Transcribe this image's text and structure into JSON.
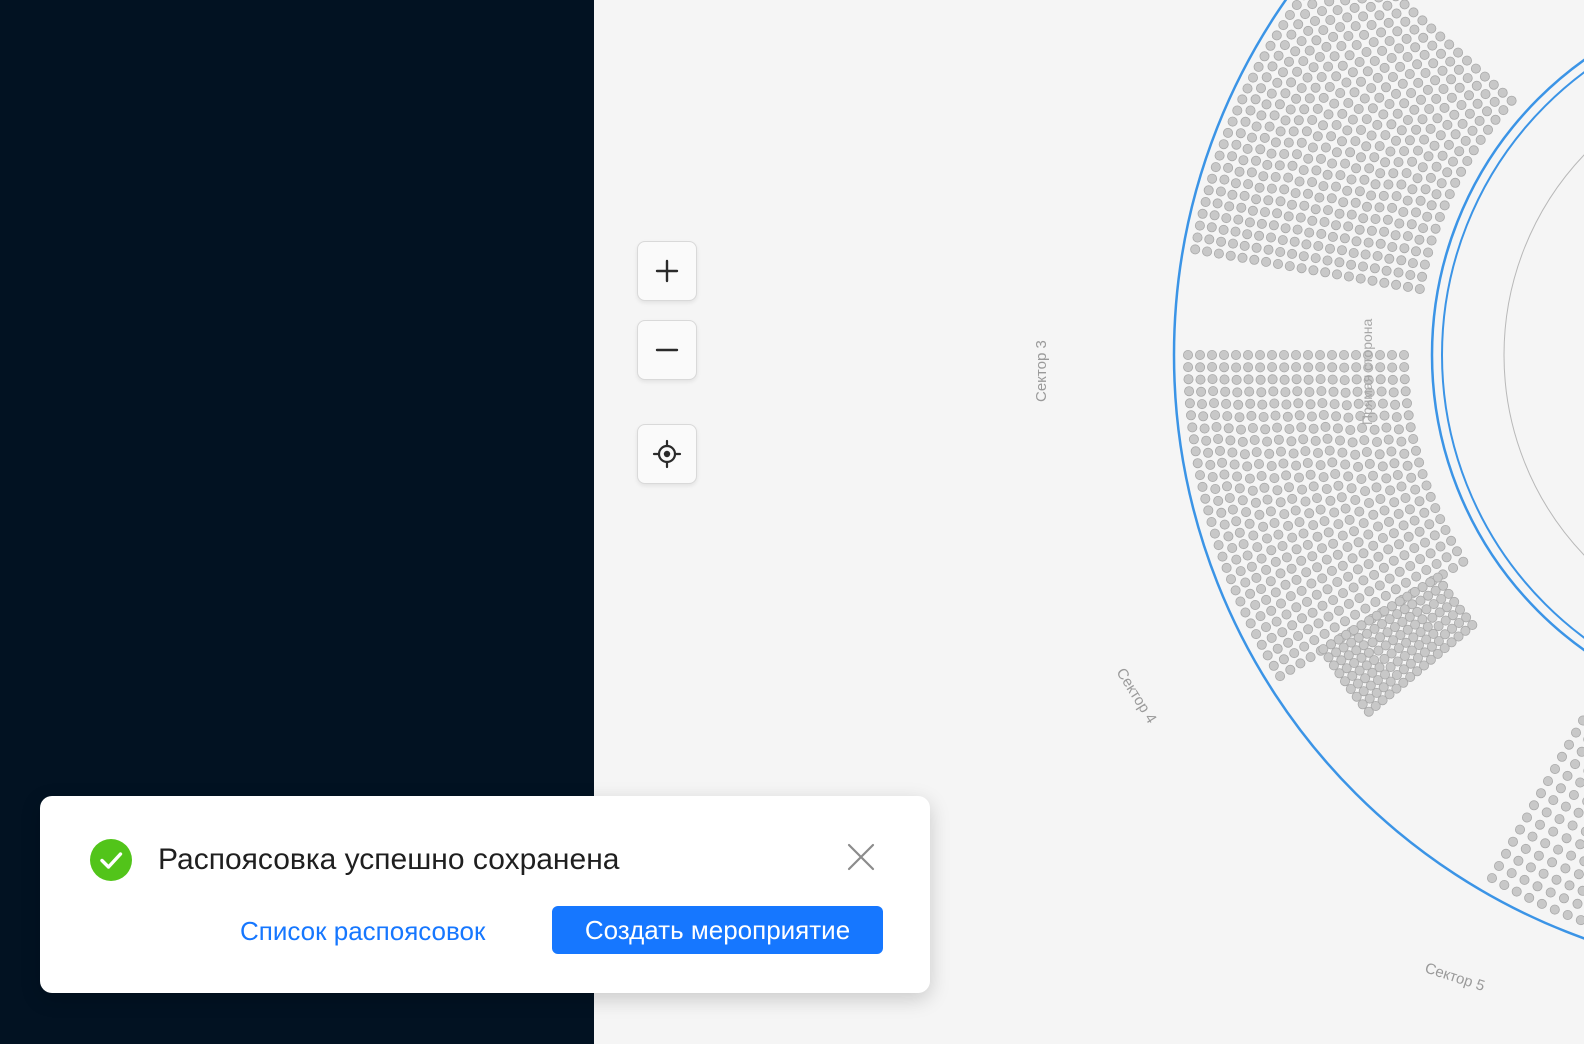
{
  "map": {
    "zoom_in_label": "+",
    "zoom_out_label": "−",
    "sectors": [
      "Сектор 3",
      "Сектор 4",
      "Сектор 5"
    ],
    "row_label": "Прямая сторона",
    "ring_color": "#3b94e6",
    "seat_color": "#c8c8c8"
  },
  "toast": {
    "icon": "check-circle-icon",
    "status_color": "#52c41a",
    "title": "Распоясовка успешно сохранена",
    "link_label": "Список распоясовок",
    "primary_label": "Создать мероприятие",
    "accent": "#1677ff"
  }
}
